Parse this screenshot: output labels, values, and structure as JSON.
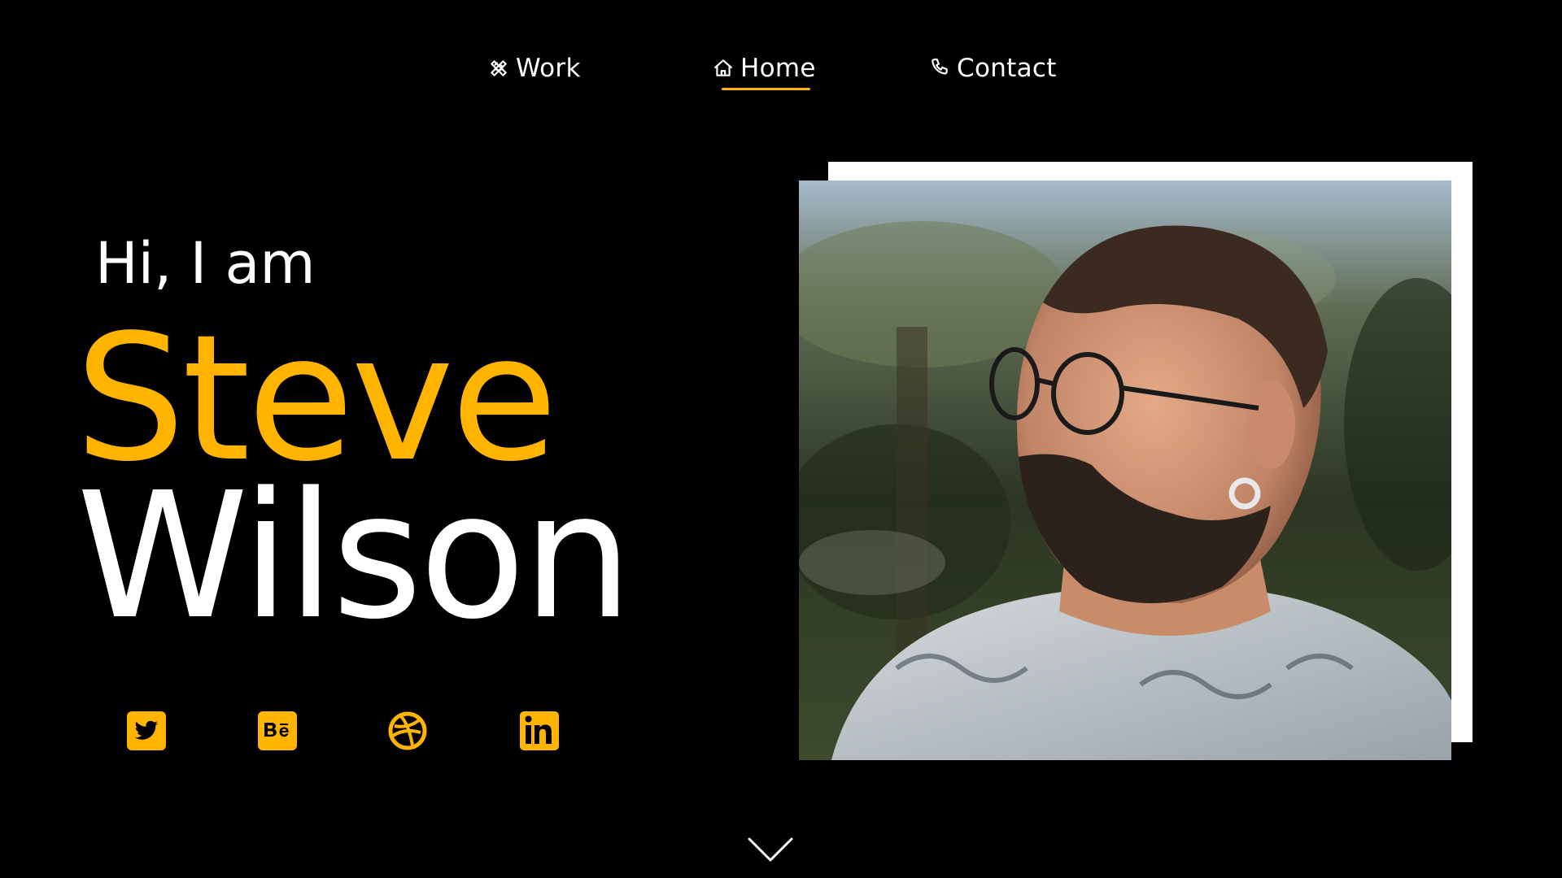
{
  "nav": {
    "items": [
      {
        "label": "Work",
        "icon": "tools-icon"
      },
      {
        "label": "Home",
        "icon": "home-icon",
        "active": true
      },
      {
        "label": "Contact",
        "icon": "phone-icon"
      }
    ]
  },
  "hero": {
    "greeting": "Hi, I am",
    "first_name": "Steve",
    "last_name": "Wilson"
  },
  "social": [
    {
      "name": "Twitter",
      "icon": "twitter-icon"
    },
    {
      "name": "Behance",
      "icon": "behance-icon"
    },
    {
      "name": "Dribbble",
      "icon": "dribbble-icon"
    },
    {
      "name": "LinkedIn",
      "icon": "linkedin-icon"
    }
  ],
  "portrait": {
    "icon": "profile-photo"
  },
  "scroll": {
    "icon": "chevron-down-icon"
  },
  "colors": {
    "background": "#000000",
    "accent": "#FFB400",
    "text": "#FFFFFF",
    "frame": "#FFFFFF"
  }
}
